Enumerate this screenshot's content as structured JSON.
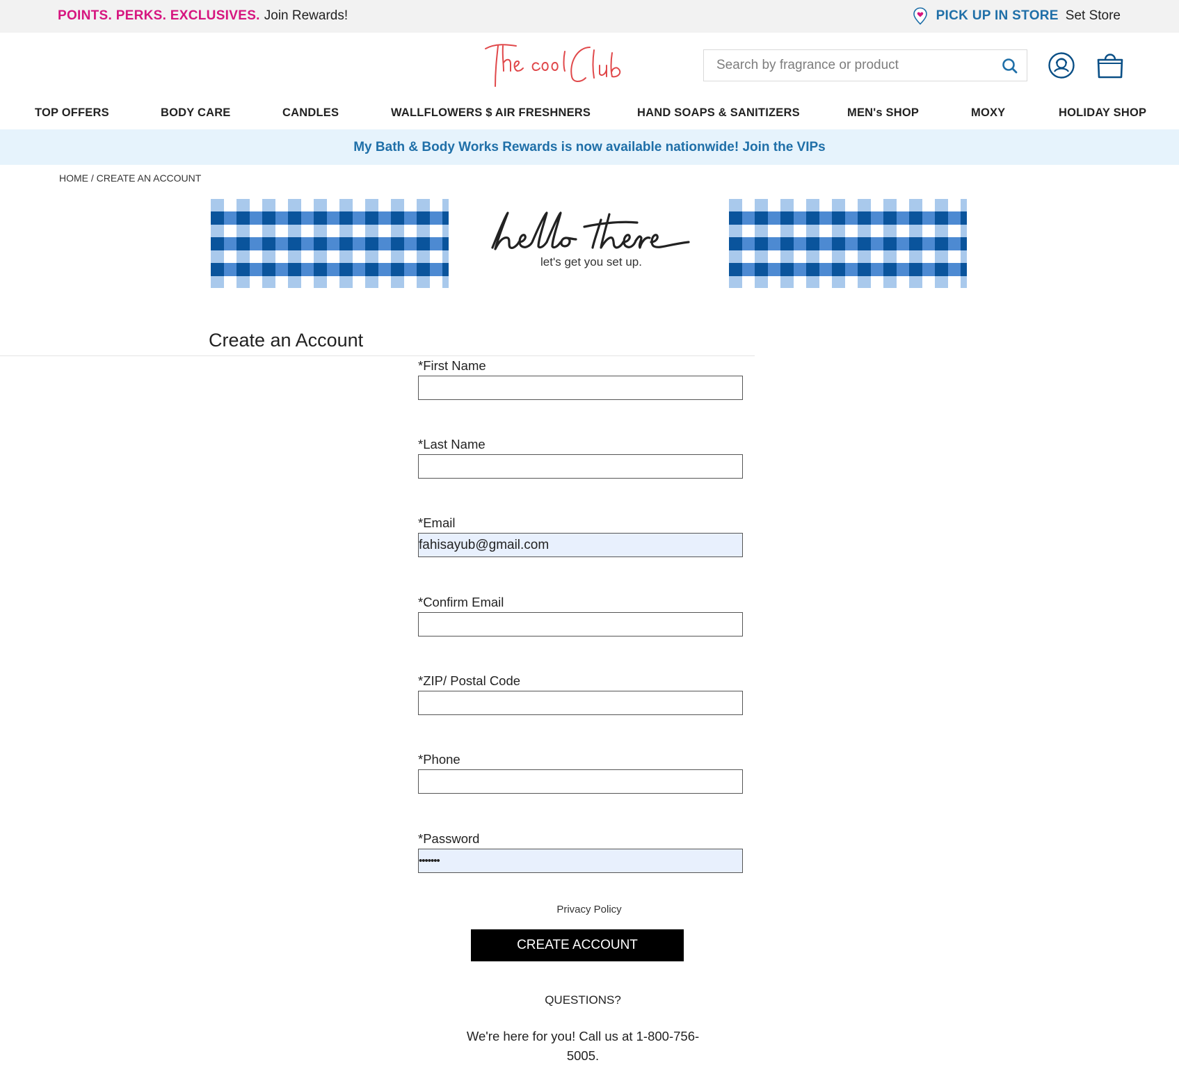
{
  "promo": {
    "perks": "POINTS. PERKS. EXCLUSIVES.",
    "join": "Join Rewards!",
    "pickup": "PICK UP IN STORE",
    "set_store": "Set Store"
  },
  "header": {
    "logo_text": "The cool Club",
    "search_placeholder": "Search by fragrance or product",
    "search_icon": "search-icon",
    "account_icon": "account-icon",
    "bag_icon": "shopping-bag-icon"
  },
  "nav": {
    "items": [
      "TOP OFFERS",
      "BODY CARE",
      "CANDLES",
      "WALLFLOWERS $ AIR FRESHNERS",
      "HAND SOAPS & SANITIZERS",
      "MEN's SHOP",
      "MOXY",
      "HOLIDAY SHOP"
    ]
  },
  "banner": {
    "text": "My Bath & Body Works Rewards is now available nationwide! Join the VIPs"
  },
  "breadcrumb": {
    "home": "HOME",
    "separator": " / ",
    "current": "CREATE AN ACCOUNT"
  },
  "hero": {
    "title": "hello there",
    "subtitle": "let's get you set up."
  },
  "form": {
    "title": "Create an Account",
    "fields": [
      {
        "label": "*First Name",
        "value": ""
      },
      {
        "label": "*Last Name",
        "value": ""
      },
      {
        "label": "*Email",
        "value": "fahisayub@gmail.com"
      },
      {
        "label": "*Confirm Email",
        "value": ""
      },
      {
        "label": "*ZIP/ Postal Code",
        "value": ""
      },
      {
        "label": "*Phone",
        "value": ""
      },
      {
        "label": "*Password",
        "value": "•••••••"
      }
    ],
    "privacy": "Privacy Policy",
    "submit": "CREATE ACCOUNT"
  },
  "help": {
    "title": "QUESTIONS?",
    "line1": "We're here for you! Call us at 1-800-756-",
    "line2": "5005."
  },
  "colors": {
    "brand_pink": "#d6157f",
    "brand_blue": "#1f6fa8",
    "banner_bg": "#e6f3fc",
    "logo_red": "#e0484a",
    "gingham_dark": "#0a549c",
    "gingham_light": "#a9c9ec"
  }
}
